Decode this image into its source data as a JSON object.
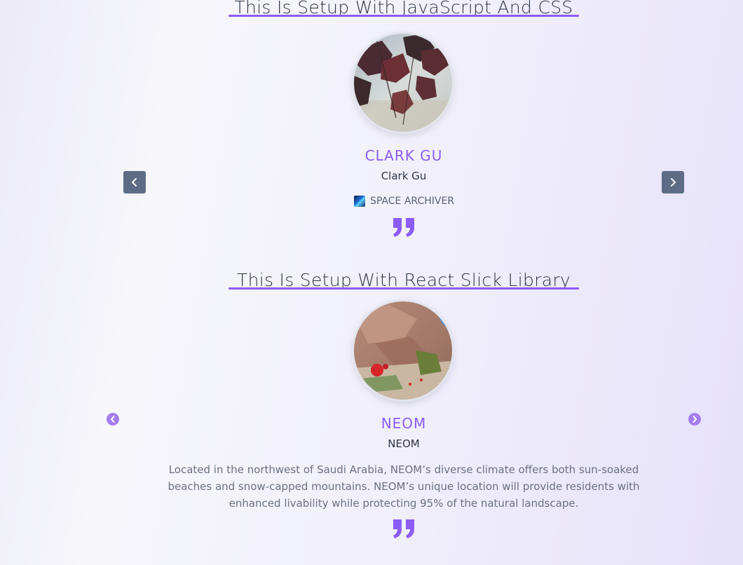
{
  "sections": [
    {
      "title": "This Is Setup With JavaScript And CSS",
      "name_upper": "CLARK GU",
      "name": "Clark Gu",
      "company": "SPACE ARCHIVER",
      "avatar_icon": "autumn-leaves-photo",
      "prev_icon": "chevron-left-icon",
      "next_icon": "chevron-right-icon"
    },
    {
      "title": "This Is Setup With React Slick Library",
      "name_upper": "NEOM",
      "name": "NEOM",
      "description": "Located in the northwest of Saudi Arabia, NEOM’s diverse climate offers both sun-soaked beaches and snow-capped mountains. NEOM’s unique location will provide residents with enhanced livability while protecting 95% of the natural landscape.",
      "avatar_icon": "desert-rocks-photo",
      "prev_icon": "arrow-circle-left-icon",
      "next_icon": "arrow-circle-right-icon"
    }
  ],
  "colors": {
    "accent": "#8b5cf6",
    "nav_button": "#5d6b84",
    "slick_arrow": "#a47ef0",
    "text": "#2f3545"
  }
}
